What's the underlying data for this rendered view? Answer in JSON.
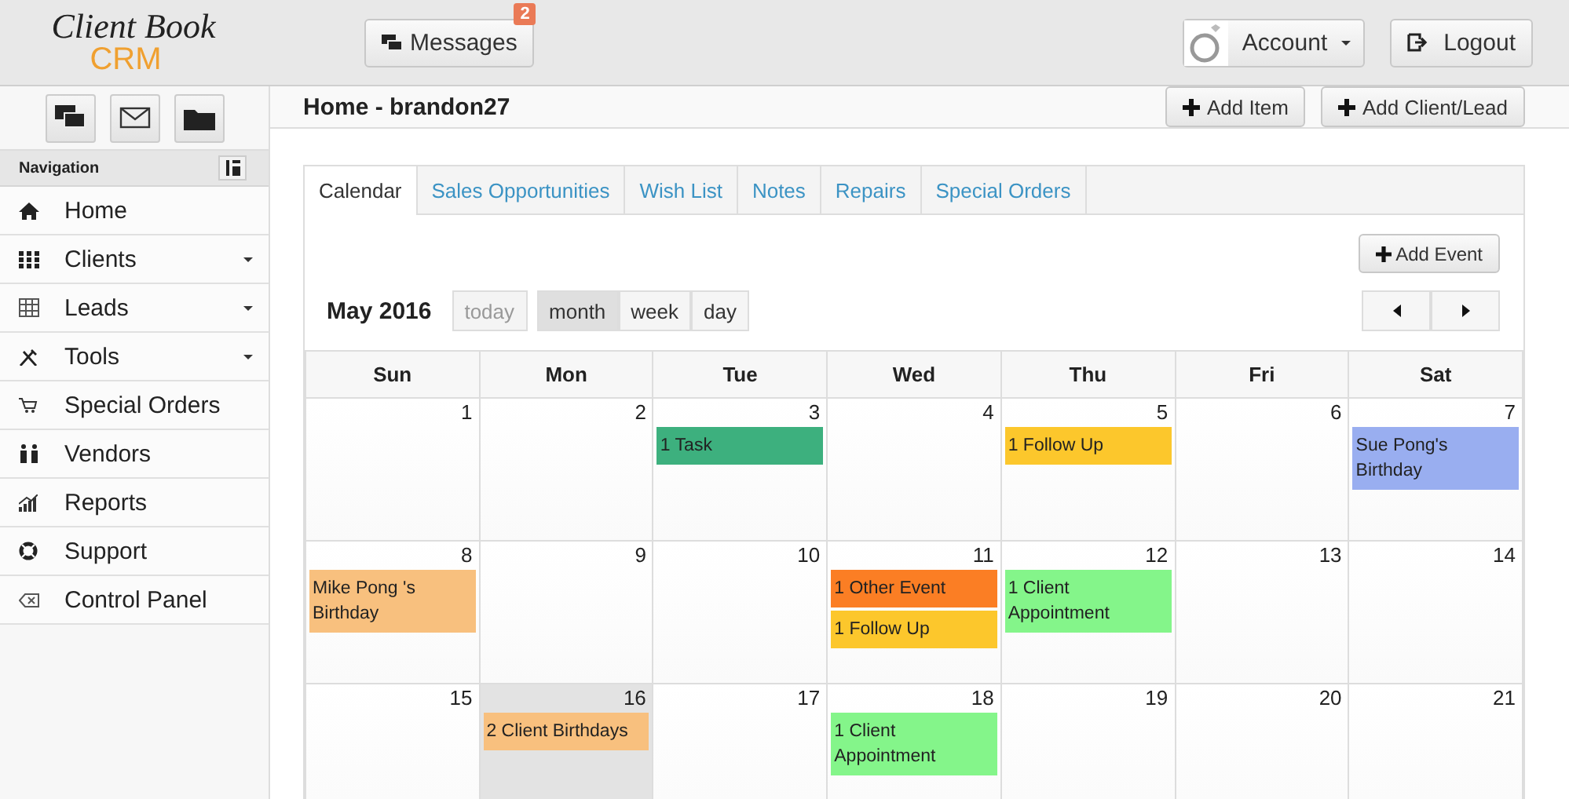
{
  "logo": {
    "script": "Client Book",
    "brand": "CRM"
  },
  "header": {
    "messages": {
      "label": "Messages",
      "badge": "2"
    },
    "account": "Account",
    "logout": "Logout"
  },
  "page_title": "Home - brandon27",
  "page_actions": [
    "Add Item",
    "Add Client/Lead"
  ],
  "sidebar": {
    "title": "Navigation",
    "items": [
      {
        "label": "Home",
        "has_menu": false
      },
      {
        "label": "Clients",
        "has_menu": true
      },
      {
        "label": "Leads",
        "has_menu": true
      },
      {
        "label": "Tools",
        "has_menu": true
      },
      {
        "label": "Special Orders",
        "has_menu": false
      },
      {
        "label": "Vendors",
        "has_menu": false
      },
      {
        "label": "Reports",
        "has_menu": false
      },
      {
        "label": "Support",
        "has_menu": false
      },
      {
        "label": "Control Panel",
        "has_menu": false
      }
    ]
  },
  "tabs": [
    {
      "label": "Calendar",
      "selected": true
    },
    {
      "label": "Sales Opportunities",
      "selected": false
    },
    {
      "label": "Wish List",
      "selected": false
    },
    {
      "label": "Notes",
      "selected": false
    },
    {
      "label": "Repairs",
      "selected": false
    },
    {
      "label": "Special Orders",
      "selected": false
    }
  ],
  "calendar": {
    "add_event": "Add Event",
    "month": "May 2016",
    "today": "today",
    "views": [
      {
        "label": "month",
        "selected": true
      },
      {
        "label": "week",
        "selected": false
      },
      {
        "label": "day",
        "selected": false
      }
    ],
    "weekdays": [
      "Sun",
      "Mon",
      "Tue",
      "Wed",
      "Thu",
      "Fri",
      "Sat"
    ],
    "weeks": [
      [
        {
          "day": "1",
          "today": false
        },
        {
          "day": "2",
          "today": false
        },
        {
          "day": "3",
          "today": false,
          "events": [
            {
              "label": "1 Task",
              "color": "#3db07e"
            }
          ]
        },
        {
          "day": "4",
          "today": false
        },
        {
          "day": "5",
          "today": false,
          "events": [
            {
              "label": "1 Follow Up",
              "color": "#fcc72c"
            }
          ]
        },
        {
          "day": "6",
          "today": false
        },
        {
          "day": "7",
          "today": false,
          "events": [
            {
              "label": "Sue Pong's Birthday",
              "color": "#99aef0"
            }
          ]
        }
      ],
      [
        {
          "day": "8",
          "today": false,
          "events": [
            {
              "label": "Mike Pong 's Birthday",
              "color": "#f8c07e"
            }
          ]
        },
        {
          "day": "9",
          "today": false
        },
        {
          "day": "10",
          "today": false
        },
        {
          "day": "11",
          "today": false,
          "events": [
            {
              "label": "1 Other Event",
              "color": "#fb7e24"
            },
            {
              "label": "1 Follow Up",
              "color": "#fcc72c"
            }
          ]
        },
        {
          "day": "12",
          "today": false,
          "events": [
            {
              "label": "1 Client Appointment",
              "color": "#84f58a"
            }
          ]
        },
        {
          "day": "13",
          "today": false
        },
        {
          "day": "14",
          "today": false
        }
      ],
      [
        {
          "day": "15",
          "today": false
        },
        {
          "day": "16",
          "today": true,
          "events": [
            {
              "label": "2 Client Birthdays",
              "color": "#f8c07e"
            }
          ]
        },
        {
          "day": "17",
          "today": false
        },
        {
          "day": "18",
          "today": false,
          "events": [
            {
              "label": "1 Client Appointment",
              "color": "#84f58a"
            }
          ]
        },
        {
          "day": "19",
          "today": false
        },
        {
          "day": "20",
          "today": false
        },
        {
          "day": "21",
          "today": false
        }
      ]
    ]
  }
}
